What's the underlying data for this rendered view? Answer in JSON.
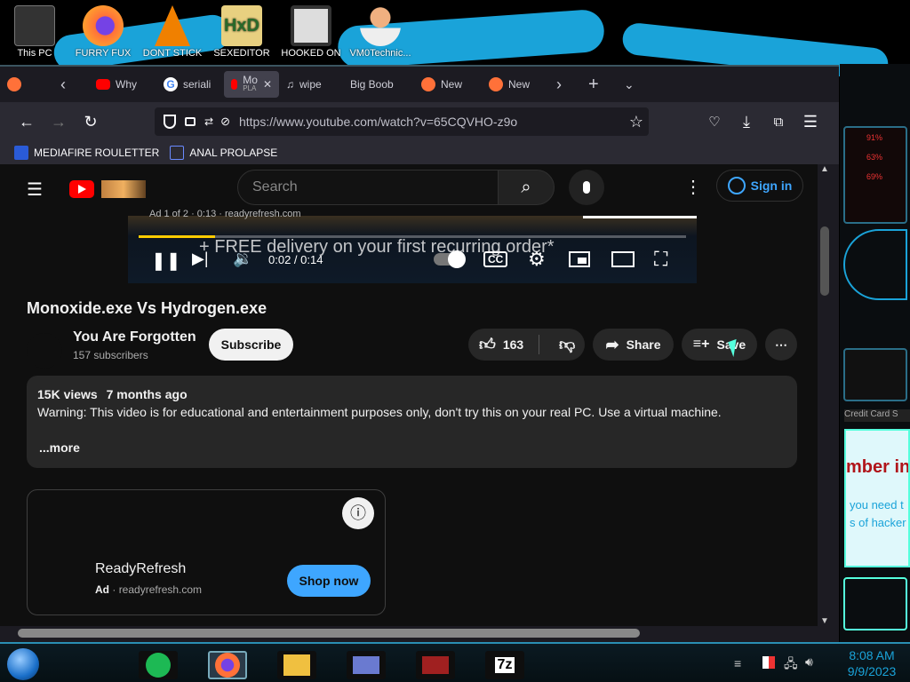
{
  "desktop": {
    "icons": [
      {
        "label": "This PC",
        "icon": "computer-icon",
        "color": "#444"
      },
      {
        "label": "FURRY FUX",
        "icon": "firefox-icon",
        "color": "#e66000"
      },
      {
        "label": "DONT STICK",
        "icon": "vlc-icon",
        "color": "#f08000"
      },
      {
        "label": "SEXEDITOR",
        "icon": "hxd-icon",
        "color": "#3a8a3a"
      },
      {
        "label": "HOOKED ON",
        "icon": "app-icon",
        "color": "#666"
      },
      {
        "label": "VM0Technic...",
        "icon": "doctor-icon",
        "color": "#e0a070"
      }
    ],
    "right_panel": {
      "label": "Credit Card S",
      "card_title": "mber in",
      "card_line1": "you need t",
      "card_line2": "s of hacker",
      "meters": [
        "91%",
        "63%",
        "69%"
      ]
    }
  },
  "browser": {
    "tabs": [
      {
        "label": "",
        "icon": "firefox-icon"
      },
      {
        "label": "",
        "icon": "chevron-left-icon"
      },
      {
        "label": "Why",
        "icon": "youtube-icon"
      },
      {
        "label": "seriali",
        "icon": "google-icon"
      },
      {
        "label": "Mo",
        "sublabel": "PLA",
        "icon": "youtube-icon",
        "active": true
      },
      {
        "label": "wipe",
        "icon": "audio-icon"
      },
      {
        "label": "Big Boob",
        "icon": ""
      },
      {
        "label": "New",
        "icon": "firefox-icon"
      },
      {
        "label": "New",
        "icon": "firefox-icon"
      }
    ],
    "url": "https://www.youtube.com/watch?v=65CQVHO-z9o",
    "bookmarks": [
      {
        "label": "MEDIAFIRE ROULETTER"
      },
      {
        "label": "ANAL PROLAPSE"
      }
    ]
  },
  "youtube": {
    "search_placeholder": "Search",
    "sign_in": "Sign in",
    "player": {
      "ad_text": "Ad 1 of 2 · 0:13 · readyrefresh.com",
      "overlay": "+ FREE delivery on your first recurring order*",
      "time": "0:02 / 0:14",
      "progress": 0.14
    },
    "title": "Monoxide.exe Vs Hydrogen.exe",
    "channel": "You Are Forgotten",
    "subscribers": "157 subscribers",
    "subscribe": "Subscribe",
    "likes": "163",
    "share": "Share",
    "save": "Save",
    "description": {
      "views": "15K views",
      "age": "7 months ago",
      "text": "Warning: This video is for educational and entertainment purposes only, don't try this on your real PC. Use a virtual machine.",
      "more": "...more"
    },
    "ad": {
      "name": "ReadyRefresh",
      "ad_label": "Ad",
      "domain": "readyrefresh.com",
      "cta": "Shop now"
    }
  },
  "taskbar": {
    "time": "8:08 AM",
    "date": "9/9/2023",
    "apps": [
      "notes-icon",
      "firefox-icon",
      "file-explorer-icon",
      "card-icon",
      "game-icon",
      "7zip-icon"
    ],
    "zip_label": "7z"
  },
  "colors": {
    "accent": "#1aa3d9",
    "yt_red": "#ff0000",
    "link_blue": "#3ea6ff"
  }
}
